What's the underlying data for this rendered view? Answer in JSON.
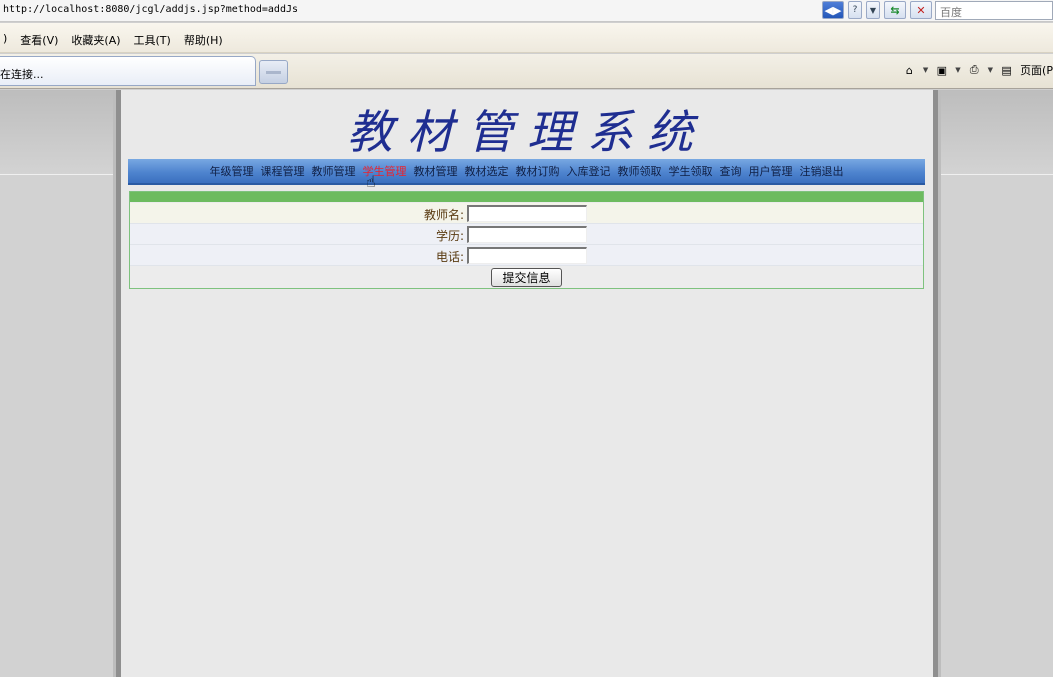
{
  "browser": {
    "url": "http://localhost:8080/jcgl/addjs.jsp?method=addJs",
    "search_placeholder": "百度",
    "menus": [
      ") ",
      "查看(V)",
      "收藏夹(A)",
      "工具(T)",
      "帮助(H)"
    ],
    "tab_title": "在连接...",
    "cmd_page_label": "页面(P"
  },
  "page": {
    "title": "教材管理系统",
    "nav": [
      "年级管理",
      "课程管理",
      "教师管理",
      "学生管理",
      "教材管理",
      "教材选定",
      "教材订购",
      "入库登记",
      "教师领取",
      "学生领取",
      "查询",
      "用户管理",
      "注销退出"
    ],
    "active_nav": "学生管理",
    "form": {
      "teacher_name_label": "教师名:",
      "education_label": "学历:",
      "phone_label": "电话:",
      "teacher_name_value": "",
      "education_value": "",
      "phone_value": "",
      "submit_label": "提交信息"
    }
  },
  "colors": {
    "title": "#1f2e91",
    "nav_active": "#e8232e",
    "form_header": "#6dbb5f"
  }
}
